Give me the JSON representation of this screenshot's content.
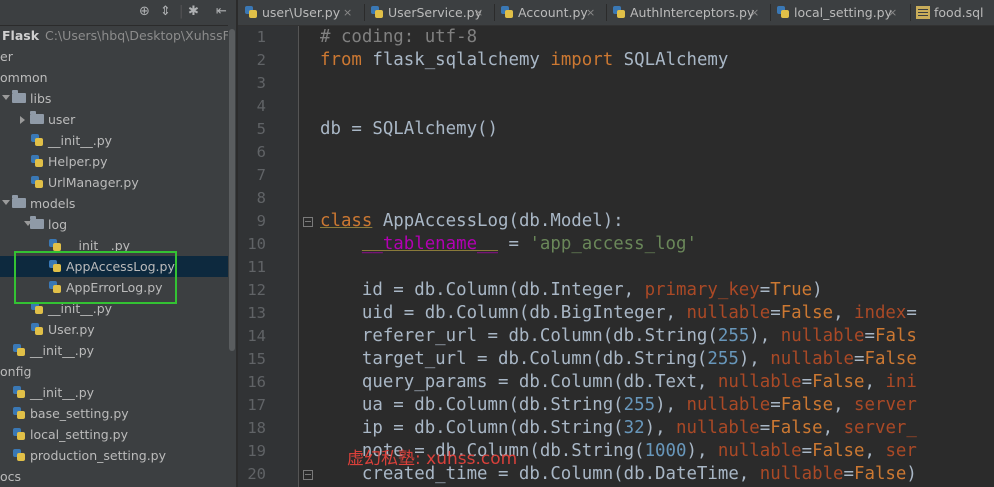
{
  "colors": {
    "keyword": "#cc7832",
    "comment": "#808080",
    "string": "#6a8759",
    "number": "#6897bb",
    "plain": "#a9b7c6",
    "param": "#aa4926",
    "dunder": "#b200b2",
    "selection": "#0d293e",
    "highlight_box": "#33c233",
    "watermark": "#d9403a"
  },
  "toolbar": {
    "icons": [
      "target-icon",
      "collapse-icon",
      "gear-icon",
      "hide-icon"
    ]
  },
  "tree": {
    "root": {
      "label": "Flask",
      "path": "C:\\Users\\hbq\\Desktop\\XuhssFlask"
    },
    "items": [
      {
        "label": "er",
        "kind": "text"
      },
      {
        "label": "ommon",
        "kind": "text"
      },
      {
        "label": "libs",
        "kind": "folder"
      },
      {
        "label": "user",
        "kind": "folder"
      },
      {
        "label": "__init__.py",
        "kind": "py"
      },
      {
        "label": "Helper.py",
        "kind": "py"
      },
      {
        "label": "UrlManager.py",
        "kind": "py"
      },
      {
        "label": "models",
        "kind": "folder"
      },
      {
        "label": "log",
        "kind": "folder"
      },
      {
        "label": "__init__.py",
        "kind": "py"
      },
      {
        "label": "AppAccessLog.py",
        "kind": "py"
      },
      {
        "label": "AppErrorLog.py",
        "kind": "py"
      },
      {
        "label": "__init__.py",
        "kind": "py"
      },
      {
        "label": "User.py",
        "kind": "py"
      },
      {
        "label": "__init__.py",
        "kind": "py"
      },
      {
        "label": "onfig",
        "kind": "text"
      },
      {
        "label": "__init__.py",
        "kind": "py"
      },
      {
        "label": "base_setting.py",
        "kind": "py"
      },
      {
        "label": "local_setting.py",
        "kind": "py"
      },
      {
        "label": "production_setting.py",
        "kind": "py"
      },
      {
        "label": "ocs",
        "kind": "text"
      }
    ]
  },
  "tabs": [
    {
      "label": "user\\User.py",
      "close": "×"
    },
    {
      "label": "UserService.py",
      "close": "×"
    },
    {
      "label": "Account.py",
      "close": "×"
    },
    {
      "label": "AuthInterceptors.py",
      "close": "×"
    },
    {
      "label": "local_setting.py",
      "close": "×"
    },
    {
      "label": "food.sql",
      "close": ""
    }
  ],
  "editor": {
    "line_numbers": [
      "1",
      "2",
      "3",
      "4",
      "5",
      "6",
      "7",
      "8",
      "9",
      "10",
      "11",
      "12",
      "13",
      "14",
      "15",
      "16",
      "17",
      "18",
      "19",
      "20"
    ],
    "lines": [
      [
        [
          "c",
          "# coding: utf-8"
        ]
      ],
      [
        [
          "k",
          "from"
        ],
        [
          "p",
          " flask_sqlalchemy "
        ],
        [
          "k",
          "import"
        ],
        [
          "p",
          " SQLAlchemy"
        ]
      ],
      [],
      [],
      [
        [
          "p",
          "db = SQLAlchemy()"
        ]
      ],
      [],
      [],
      [],
      [
        [
          "k",
          "class"
        ],
        [
          "p",
          " AppAccessLog(db.Model):"
        ]
      ],
      [
        [
          "p",
          "    "
        ],
        [
          "d",
          "__tablename__"
        ],
        [
          "p",
          " = "
        ],
        [
          "s",
          "'app_access_log'"
        ]
      ],
      [],
      [
        [
          "p",
          "    id = db.Column(db.Integer, "
        ],
        [
          "a",
          "primary_key"
        ],
        [
          "p",
          "="
        ],
        [
          "k",
          "True"
        ],
        [
          "p",
          ")"
        ]
      ],
      [
        [
          "p",
          "    uid = db.Column(db.BigInteger, "
        ],
        [
          "a",
          "nullable"
        ],
        [
          "p",
          "="
        ],
        [
          "k",
          "False"
        ],
        [
          "p",
          ", "
        ],
        [
          "a",
          "index"
        ],
        [
          "p",
          "="
        ]
      ],
      [
        [
          "p",
          "    referer_url = db.Column(db.String("
        ],
        [
          "n",
          "255"
        ],
        [
          "p",
          "), "
        ],
        [
          "a",
          "nullable"
        ],
        [
          "p",
          "="
        ],
        [
          "k",
          "Fals"
        ]
      ],
      [
        [
          "p",
          "    target_url = db.Column(db.String("
        ],
        [
          "n",
          "255"
        ],
        [
          "p",
          "), "
        ],
        [
          "a",
          "nullable"
        ],
        [
          "p",
          "="
        ],
        [
          "k",
          "False"
        ]
      ],
      [
        [
          "p",
          "    query_params = db.Column(db.Text, "
        ],
        [
          "a",
          "nullable"
        ],
        [
          "p",
          "="
        ],
        [
          "k",
          "False"
        ],
        [
          "p",
          ", "
        ],
        [
          "a",
          "ini"
        ]
      ],
      [
        [
          "p",
          "    ua = db.Column(db.String("
        ],
        [
          "n",
          "255"
        ],
        [
          "p",
          "), "
        ],
        [
          "a",
          "nullable"
        ],
        [
          "p",
          "="
        ],
        [
          "k",
          "False"
        ],
        [
          "p",
          ", "
        ],
        [
          "a",
          "server"
        ]
      ],
      [
        [
          "p",
          "    ip = db.Column(db.String("
        ],
        [
          "n",
          "32"
        ],
        [
          "p",
          "), "
        ],
        [
          "a",
          "nullable"
        ],
        [
          "p",
          "="
        ],
        [
          "k",
          "False"
        ],
        [
          "p",
          ", "
        ],
        [
          "a",
          "server_"
        ]
      ],
      [
        [
          "p",
          "    note = db.Column(db.String("
        ],
        [
          "n",
          "1000"
        ],
        [
          "p",
          "), "
        ],
        [
          "a",
          "nullable"
        ],
        [
          "p",
          "="
        ],
        [
          "k",
          "False"
        ],
        [
          "p",
          ", "
        ],
        [
          "a",
          "ser"
        ]
      ],
      [
        [
          "p",
          "    created_time = db.Column(db.DateTime, "
        ],
        [
          "a",
          "nullable"
        ],
        [
          "p",
          "="
        ],
        [
          "k",
          "False"
        ],
        [
          "p",
          ")"
        ]
      ]
    ]
  },
  "watermark": "虚幻私塾: xuhss.com"
}
